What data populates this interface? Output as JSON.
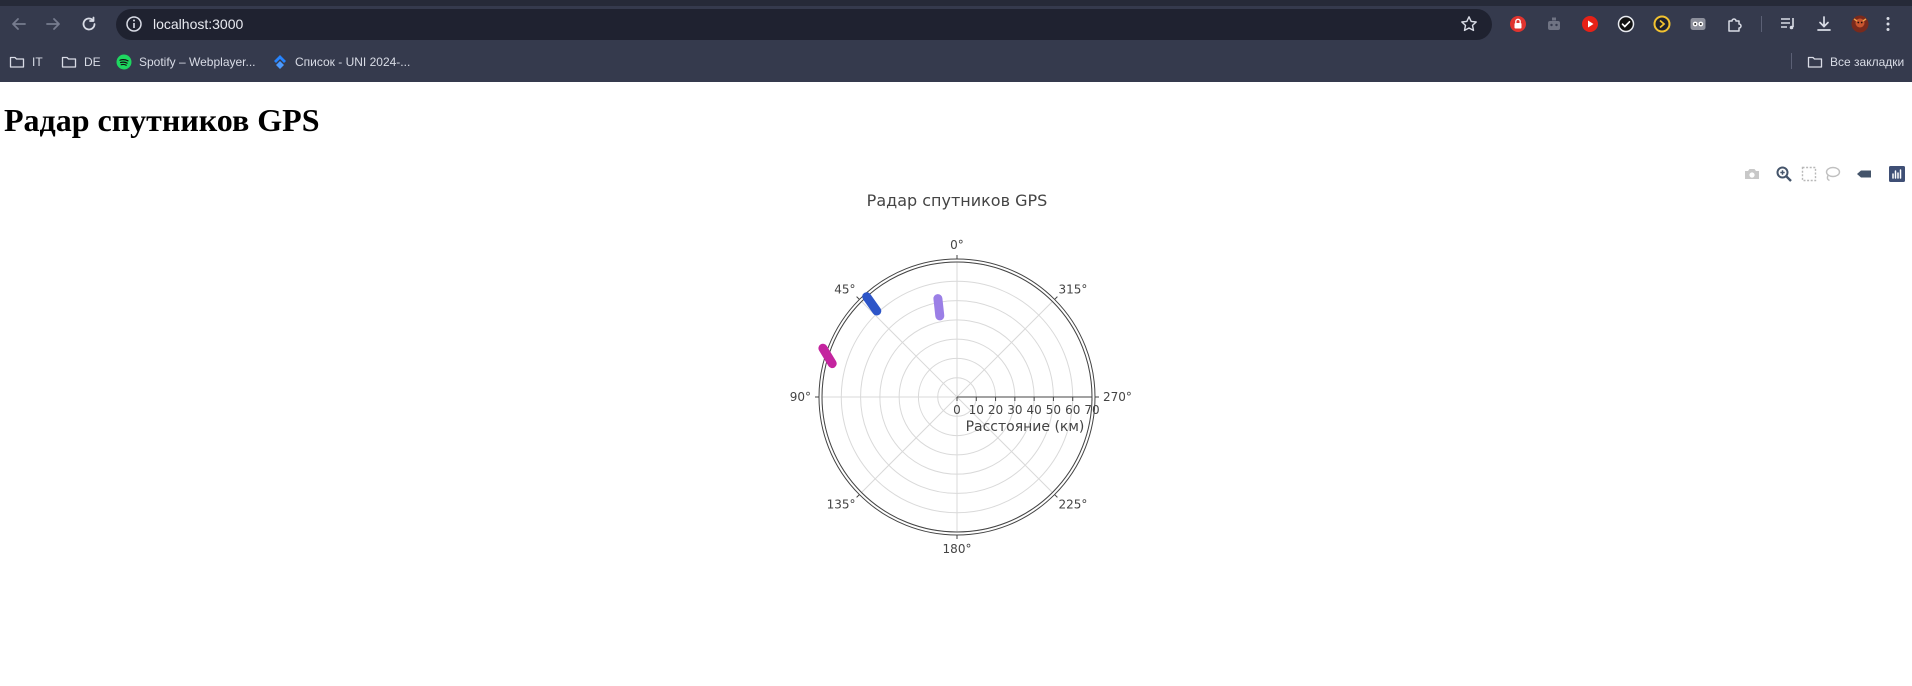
{
  "browser": {
    "url": "localhost:3000",
    "bookmarks": [
      {
        "label": "IT",
        "icon": "folder-icon"
      },
      {
        "label": "DE",
        "icon": "folder-icon"
      },
      {
        "label": "Spotify – Webplayer...",
        "icon": "spotify-icon"
      },
      {
        "label": "Список - UNI 2024-...",
        "icon": "jira-icon"
      }
    ],
    "all_bookmarks_label": "Все закладки"
  },
  "page": {
    "heading": "Радар спутников GPS"
  },
  "modebar": {
    "buttons": [
      "camera-icon",
      "zoom-icon",
      "box-select-icon",
      "lasso-icon",
      "hover-icon",
      "plotly-logo-icon"
    ]
  },
  "chart_data": {
    "type": "polar-line",
    "title": "Радар спутников GPS",
    "radial_axis": {
      "title": "Расстояние (км)",
      "range": [
        0,
        70
      ],
      "tickvals": [
        0,
        10,
        20,
        30,
        40,
        50,
        60,
        70
      ],
      "ticktext": [
        "0",
        "10",
        "20",
        "30",
        "40",
        "50",
        "60",
        "70"
      ]
    },
    "angular_axis": {
      "rotation": 90,
      "direction": "counterclockwise",
      "tickvals": [
        0,
        45,
        90,
        135,
        180,
        225,
        270,
        315
      ],
      "ticktext": [
        "0°",
        "45°",
        "90°",
        "135°",
        "180°",
        "225°",
        "270°",
        "315°"
      ]
    },
    "series": [
      {
        "color": "#9b7fe6",
        "r": [
          43,
          52
        ],
        "theta": [
          12,
          11
        ]
      },
      {
        "color": "#2d55c8",
        "r": [
          61,
          70
        ],
        "theta": [
          43,
          42
        ]
      },
      {
        "color": "#c4249f",
        "r": [
          67,
          74
        ],
        "theta": [
          75,
          70
        ]
      }
    ]
  }
}
